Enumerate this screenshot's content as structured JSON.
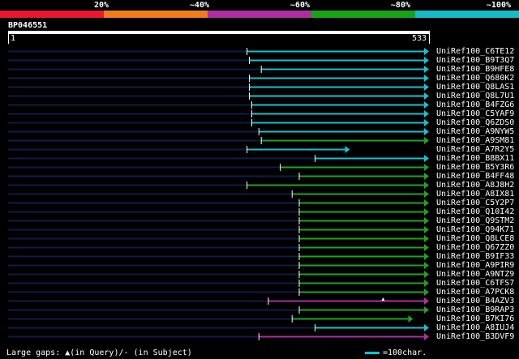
{
  "legend": {
    "labels": [
      "20%",
      "~40%",
      "~60%",
      "~80%",
      "~100%"
    ],
    "colors": [
      "#e8182f",
      "#f07d1c",
      "#b02da0",
      "#19a31a",
      "#13bcc7"
    ]
  },
  "query": {
    "id": "BP046551",
    "start_label": "1",
    "end_label": "533",
    "length": 533
  },
  "hits": [
    {
      "name": "UniRef100_C6TE12",
      "start": 303,
      "end": 533,
      "color": "#13c1d0",
      "arrow": true
    },
    {
      "name": "UniRef100_B9T3Q7",
      "start": 306,
      "end": 533,
      "color": "#13c1d0",
      "arrow": true
    },
    {
      "name": "UniRef100_B9HFE8",
      "start": 321,
      "end": 533,
      "color": "#13c1d0",
      "arrow": true
    },
    {
      "name": "UniRef100_Q680K2",
      "start": 306,
      "end": 533,
      "color": "#13c1d0",
      "arrow": true
    },
    {
      "name": "UniRef100_Q8LAS1",
      "start": 306,
      "end": 533,
      "color": "#13c1d0",
      "arrow": true
    },
    {
      "name": "UniRef100_Q8L7U1",
      "start": 306,
      "end": 533,
      "color": "#13c1d0",
      "arrow": true
    },
    {
      "name": "UniRef100_B4FZG6",
      "start": 309,
      "end": 533,
      "color": "#13c1d0",
      "arrow": true
    },
    {
      "name": "UniRef100_C5YAF9",
      "start": 309,
      "end": 533,
      "color": "#13c1d0",
      "arrow": true
    },
    {
      "name": "UniRef100_Q6ZDS0",
      "start": 309,
      "end": 533,
      "color": "#13c1d0",
      "arrow": true
    },
    {
      "name": "UniRef100_A9NYW5",
      "start": 318,
      "end": 533,
      "color": "#13c1d0",
      "arrow": true
    },
    {
      "name": "UniRef100_A9SM81",
      "start": 321,
      "end": 533,
      "color": "#1fa31f",
      "arrow": true
    },
    {
      "name": "UniRef100_A7R2Y5",
      "start": 303,
      "end": 433,
      "color": "#13c1d0",
      "arrow": true
    },
    {
      "name": "UniRef100_B8BX11",
      "start": 389,
      "end": 533,
      "color": "#13c1d0",
      "arrow": true
    },
    {
      "name": "UniRef100_B5Y3R6",
      "start": 345,
      "end": 533,
      "color": "#1fa31f",
      "arrow": true
    },
    {
      "name": "UniRef100_B4FF48",
      "start": 369,
      "end": 533,
      "color": "#1fa31f",
      "arrow": true
    },
    {
      "name": "UniRef100_A8J8H2",
      "start": 303,
      "end": 533,
      "color": "#1fa31f",
      "arrow": true
    },
    {
      "name": "UniRef100_A8IX81",
      "start": 360,
      "end": 533,
      "color": "#1fa31f",
      "arrow": true
    },
    {
      "name": "UniRef100_C5Y2P7",
      "start": 369,
      "end": 533,
      "color": "#1fa31f",
      "arrow": true
    },
    {
      "name": "UniRef100_Q10I42",
      "start": 369,
      "end": 533,
      "color": "#1fa31f",
      "arrow": true
    },
    {
      "name": "UniRef100_Q9STM2",
      "start": 369,
      "end": 533,
      "color": "#1fa31f",
      "arrow": true
    },
    {
      "name": "UniRef100_Q94K71",
      "start": 369,
      "end": 533,
      "color": "#1fa31f",
      "arrow": true
    },
    {
      "name": "UniRef100_Q8LCE8",
      "start": 369,
      "end": 533,
      "color": "#1fa31f",
      "arrow": true
    },
    {
      "name": "UniRef100_Q67ZZ0",
      "start": 369,
      "end": 533,
      "color": "#1fa31f",
      "arrow": true
    },
    {
      "name": "UniRef100_B9IF33",
      "start": 369,
      "end": 533,
      "color": "#1fa31f",
      "arrow": true
    },
    {
      "name": "UniRef100_A9PIR9",
      "start": 369,
      "end": 533,
      "color": "#1fa31f",
      "arrow": true
    },
    {
      "name": "UniRef100_A9NTZ9",
      "start": 369,
      "end": 533,
      "color": "#1fa31f",
      "arrow": true
    },
    {
      "name": "UniRef100_C6TFS7",
      "start": 369,
      "end": 533,
      "color": "#1fa31f",
      "arrow": true
    },
    {
      "name": "UniRef100_A7PCK8",
      "start": 369,
      "end": 533,
      "color": "#1fa31f",
      "arrow": true
    },
    {
      "name": "UniRef100_B4AZV3",
      "start": 330,
      "end": 533,
      "color": "#b02da0",
      "arrow": true,
      "gap_at": 475
    },
    {
      "name": "UniRef100_B9RAP3",
      "start": 369,
      "end": 533,
      "color": "#1fa31f",
      "arrow": true
    },
    {
      "name": "UniRef100_B7KI76",
      "start": 360,
      "end": 513,
      "color": "#1fa31f",
      "arrow": true
    },
    {
      "name": "UniRef100_A8IUJ4",
      "start": 389,
      "end": 533,
      "color": "#13c1d0",
      "arrow": true
    },
    {
      "name": "UniRef100_B3DVF9",
      "start": 318,
      "end": 533,
      "color": "#b02da0",
      "arrow": true
    }
  ],
  "footer": {
    "gaps_text": "Large gaps: ▲(in Query)/- (in Subject)",
    "scale_text": "=100char."
  }
}
